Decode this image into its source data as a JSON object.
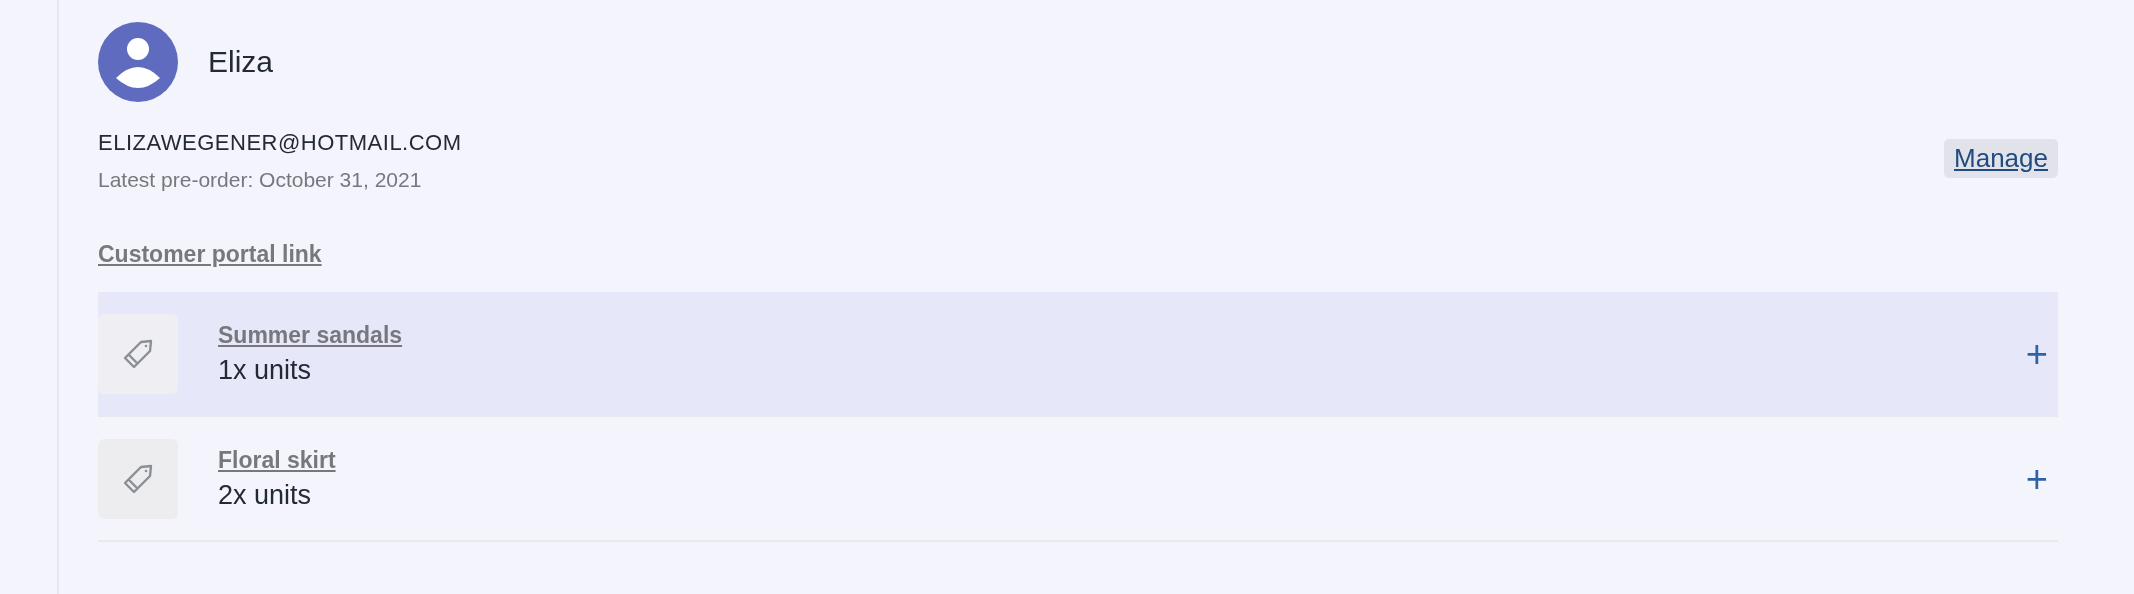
{
  "customer": {
    "name": "Eliza",
    "email": "ELIZAWEGENER@HOTMAIL.COM",
    "latest_preorder": "Latest pre-order: October 31, 2021",
    "manage_button": "Manage",
    "portal_link": "Customer portal link"
  },
  "products": [
    {
      "name": "Summer sandals",
      "quantity": "1x units",
      "add": "+",
      "selected": true
    },
    {
      "name": "Floral skirt",
      "quantity": "2x units",
      "add": "+",
      "selected": false
    }
  ]
}
